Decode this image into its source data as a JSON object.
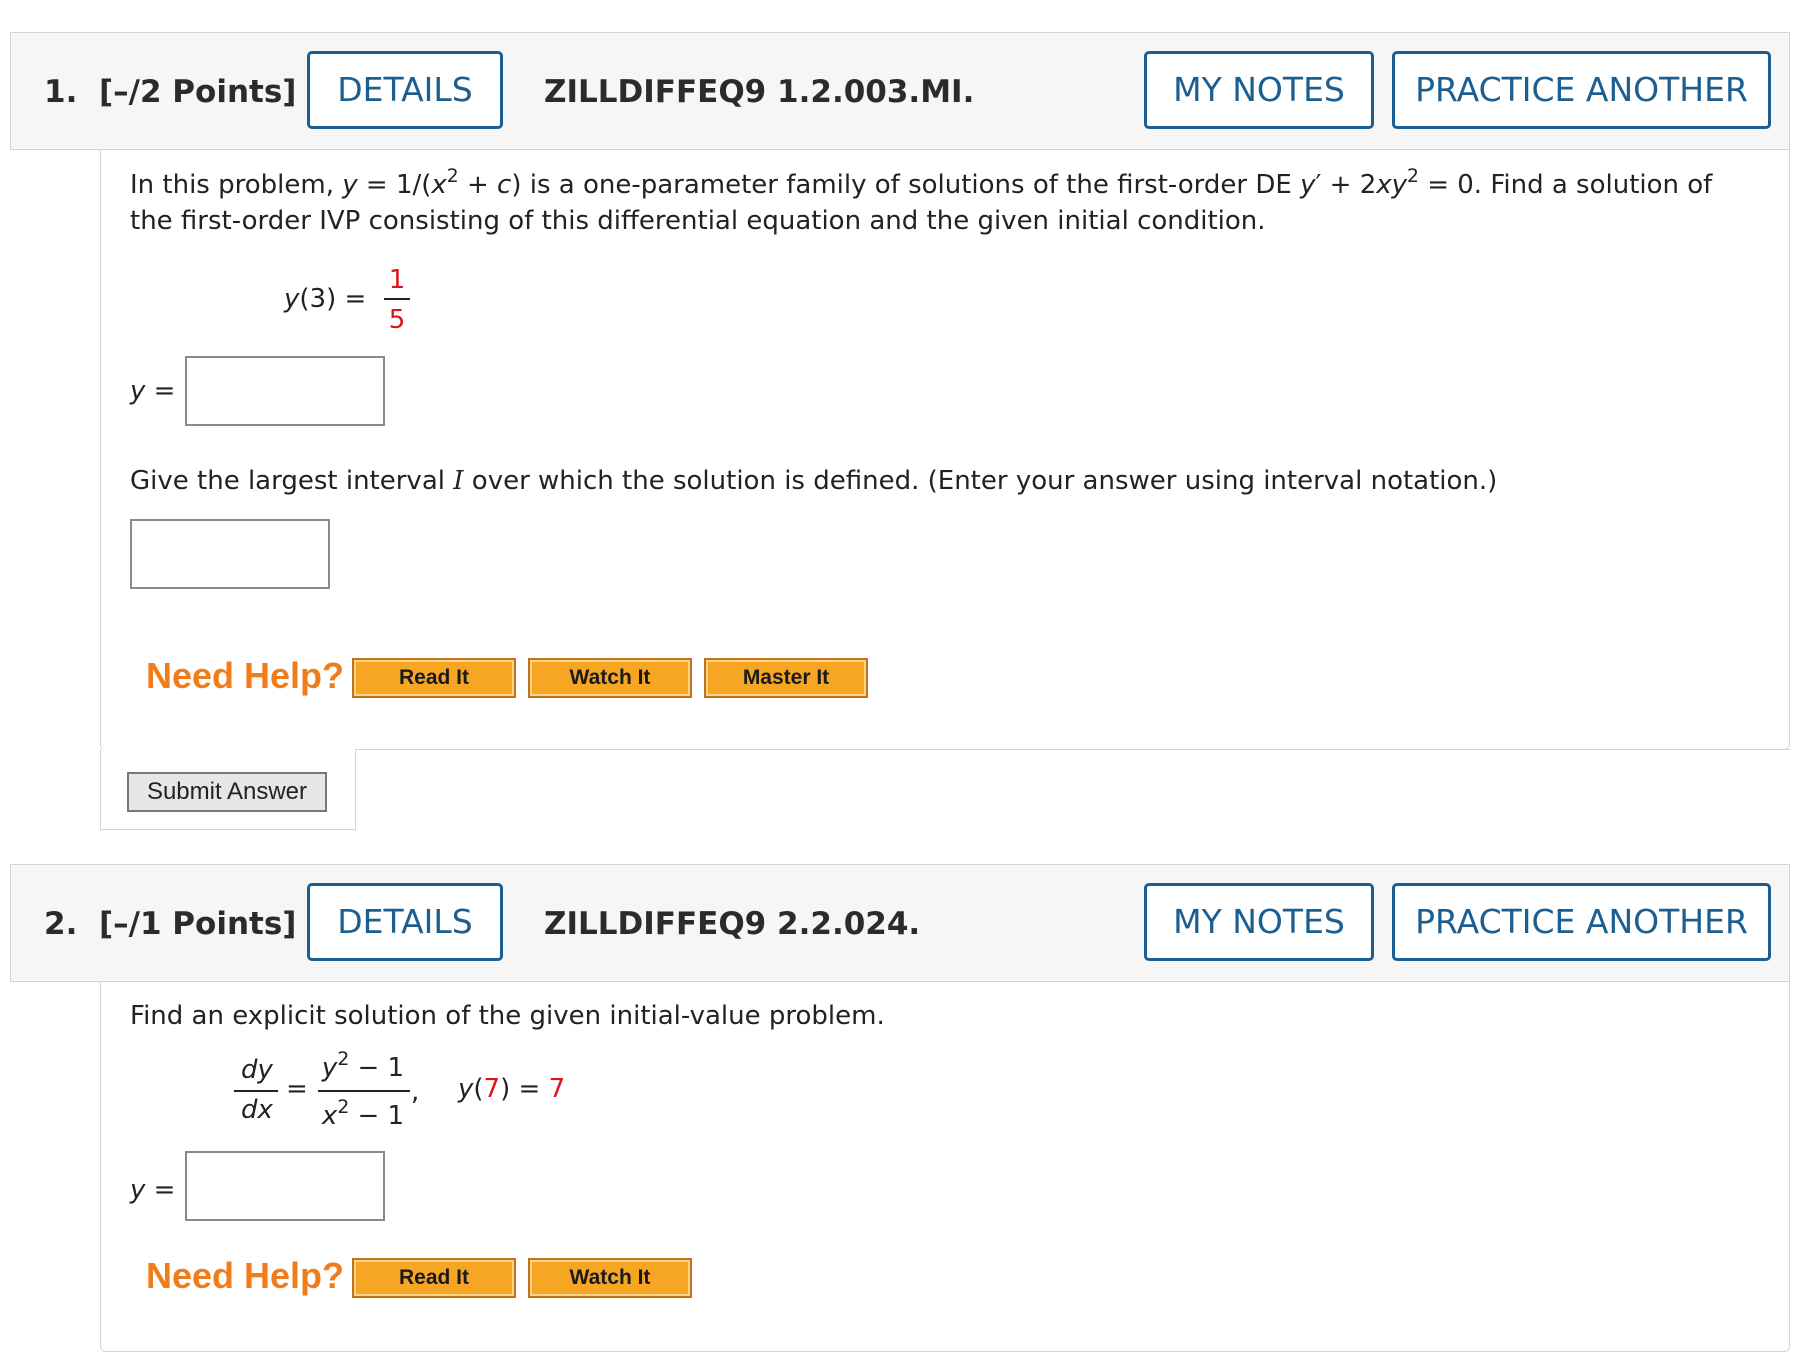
{
  "q1": {
    "number": "1.",
    "points": "[–/2 Points]",
    "details": "DETAILS",
    "code": "ZILLDIFFEQ9 1.2.003.MI.",
    "my_notes": "MY NOTES",
    "practice": "PRACTICE ANOTHER",
    "p1_a": "In this problem, ",
    "p1_y": "y",
    "p1_b": " = 1/(",
    "p1_x": "x",
    "p1_sup1": "2",
    "p1_c_pre": " + ",
    "p1_c": "c",
    "p1_d": ") is a one-parameter family of solutions of the first-order DE ",
    "p1_yp": "y",
    "p1_e": "′ + 2",
    "p1_xy": "xy",
    "p1_sup2": "2",
    "p1_f": " = 0. Find a solution of",
    "p1_line2": "the first-order IVP consisting of this differential equation and the given initial condition.",
    "ic_y": "y",
    "ic_arg": "(3) =",
    "ic_num": "1",
    "ic_den": "5",
    "ans_y": "y",
    "ans_eq": " =",
    "p2_a": "Give the largest interval ",
    "p2_I": "I",
    "p2_b": " over which the solution is defined. (Enter your answer using interval notation.)",
    "need_help": "Need Help?",
    "read_it": "Read It",
    "watch_it": "Watch It",
    "master_it": "Master It",
    "submit": "Submit Answer"
  },
  "q2": {
    "number": "2.",
    "points": "[–/1 Points]",
    "details": "DETAILS",
    "code": "ZILLDIFFEQ9 2.2.024.",
    "my_notes": "MY NOTES",
    "practice": "PRACTICE ANOTHER",
    "prompt": "Find an explicit solution of the given initial-value problem.",
    "dy": "dy",
    "dx": "dx",
    "eq": "=",
    "num_y": "y",
    "num_sup": "2",
    "num_rest": " − 1",
    "den_x": "x",
    "den_sup": "2",
    "den_rest": " − 1",
    "comma": ",",
    "ic_y": "y",
    "ic_open": "(",
    "ic_arg": "7",
    "ic_close": ") = ",
    "ic_val": "7",
    "ans_y": "y",
    "ans_eq": " =",
    "need_help": "Need Help?",
    "read_it": "Read It",
    "watch_it": "Watch It"
  }
}
